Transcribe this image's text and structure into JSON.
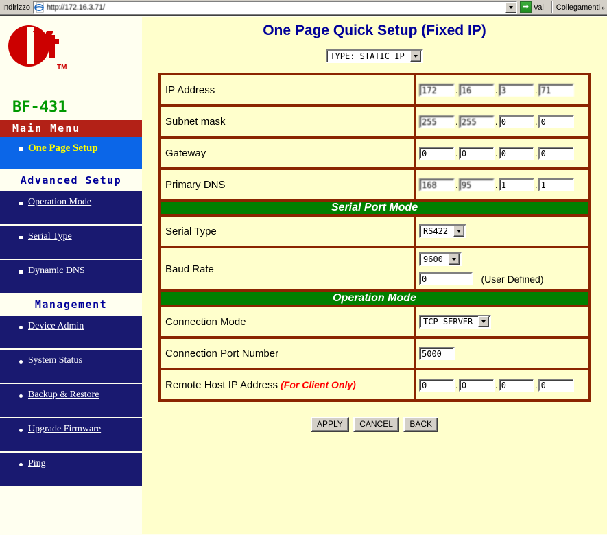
{
  "browser": {
    "address_label": "Indirizzo",
    "url": "http://172.16.3.71/",
    "go_label": "Vai",
    "links_label": "Collegamenti",
    "favicon": "ie-page-icon",
    "dropdown_icon": "chevron-down-icon",
    "go_icon": "green-arrow-right-icon",
    "links_chevron": "double-chevron-right-icon"
  },
  "sidebar": {
    "logo_alt": "cyt-logo",
    "logo_tm": "TM",
    "model": "BF-431",
    "sections": [
      {
        "header": "Main Menu",
        "header_style": "red",
        "items": [
          {
            "label": "One Page Setup",
            "bullet": "square",
            "active": true
          }
        ]
      },
      {
        "header": "Advanced Setup",
        "header_style": "plain",
        "items": [
          {
            "label": "Operation Mode",
            "bullet": "square",
            "active": false
          },
          {
            "label": "Serial Type",
            "bullet": "square",
            "active": false
          },
          {
            "label": "Dynamic DNS",
            "bullet": "square",
            "active": false
          }
        ]
      },
      {
        "header": "Management",
        "header_style": "plain",
        "items": [
          {
            "label": "Device Admin",
            "bullet": "dot",
            "active": false
          },
          {
            "label": "System Status",
            "bullet": "dot",
            "active": false
          },
          {
            "label": "Backup & Restore",
            "bullet": "dot",
            "active": false
          },
          {
            "label": "Upgrade Firmware",
            "bullet": "dot",
            "active": false
          },
          {
            "label": "Ping",
            "bullet": "dot",
            "active": false
          }
        ]
      }
    ]
  },
  "main": {
    "title": "One Page Quick Setup (Fixed IP)",
    "type_select": {
      "label": "TYPE: STATIC IP",
      "arrow_icon": "chevron-down-icon"
    },
    "network": {
      "ip_address": {
        "label": "IP Address",
        "octets": [
          "172",
          "16",
          "3",
          "71"
        ],
        "obscured": true
      },
      "subnet_mask": {
        "label": "Subnet mask",
        "octets": [
          "255",
          "255",
          "0",
          "0"
        ],
        "obscured": true
      },
      "gateway": {
        "label": "Gateway",
        "octets": [
          "0",
          "0",
          "0",
          "0"
        ],
        "obscured": false
      },
      "primary_dns": {
        "label": "Primary DNS",
        "octets": [
          "168",
          "95",
          "1",
          "1"
        ],
        "obscured": true
      }
    },
    "serial_port_mode": {
      "section_title": "Serial Port Mode",
      "serial_type": {
        "label": "Serial Type",
        "value": "RS422",
        "arrow_icon": "chevron-down-icon"
      },
      "baud_rate": {
        "label": "Baud Rate",
        "value": "9600",
        "arrow_icon": "chevron-down-icon",
        "user_defined_value": "0",
        "user_defined_label": "(User Defined)"
      }
    },
    "operation_mode": {
      "section_title": "Operation Mode",
      "connection_mode": {
        "label": "Connection Mode",
        "value": "TCP SERVER",
        "arrow_icon": "chevron-down-icon"
      },
      "connection_port": {
        "label": "Connection Port Number",
        "value": "5000"
      },
      "remote_host": {
        "label": "Remote Host  IP Address",
        "note": "(For Client Only)",
        "octets": [
          "0",
          "0",
          "0",
          "0"
        ]
      }
    },
    "buttons": {
      "apply": "APPLY",
      "cancel": "CANCEL",
      "back": "BACK"
    }
  },
  "colors": {
    "accent_green": "#008000",
    "menu_red": "#B32117",
    "nav_blue": "#191970",
    "nav_active_blue": "#0B66E8",
    "title_blue": "#000099",
    "model_green": "#009900",
    "logo_red": "#CC0000",
    "page_bg": "#FFFFCC",
    "sidebar_bg": "#FFFFF0",
    "table_border": "#8B2500",
    "note_red": "#FF0000"
  }
}
